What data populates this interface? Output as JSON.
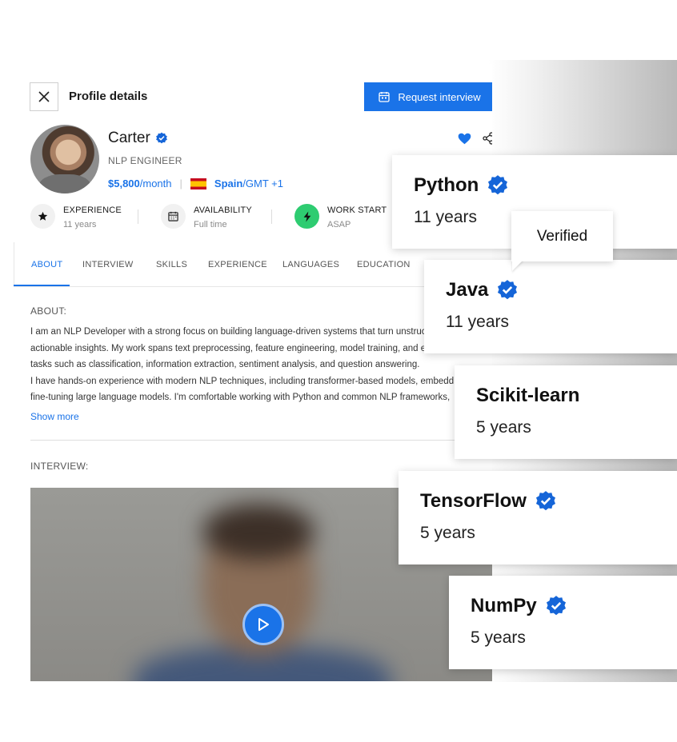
{
  "header": {
    "title": "Profile details",
    "request_button": "Request interview"
  },
  "profile": {
    "name": "Carter",
    "role": "NLP ENGINEER",
    "rate_amount": "$5,800",
    "rate_unit": "/month",
    "country": "Spain",
    "timezone": "/GMT +1"
  },
  "stats": [
    {
      "label": "EXPERIENCE",
      "value": "11 years",
      "icon": "star-icon"
    },
    {
      "label": "AVAILABILITY",
      "value": "Full time",
      "icon": "calendar-icon"
    },
    {
      "label": "WORK START",
      "value": "ASAP",
      "icon": "bolt-icon"
    }
  ],
  "tabs": [
    "ABOUT",
    "INTERVIEW",
    "SKILLS",
    "EXPERIENCE",
    "LANGUAGES",
    "EDUCATION"
  ],
  "about": {
    "heading": "ABOUT:",
    "lines": [
      "I am an NLP Developer with a strong focus on building language-driven systems that turn unstruc",
      "actionable insights. My work spans text preprocessing, feature engineering, model training, and e",
      "tasks such as classification, information extraction, sentiment analysis, and question answering.",
      "I have hands-on experience with modern NLP techniques, including transformer-based models, embedd",
      "fine-tuning large language models. I'm comfortable working with Python and common NLP frameworks,"
    ],
    "show_more": "Show more"
  },
  "interview": {
    "heading": "INTERVIEW:"
  },
  "skill_cards": [
    {
      "skill": "Python",
      "years": "11 years",
      "verified": true
    },
    {
      "skill": "Java",
      "years": "11 years",
      "verified": true
    },
    {
      "skill": "Scikit-learn",
      "years": "5 years",
      "verified": false
    },
    {
      "skill": "TensorFlow",
      "years": "5 years",
      "verified": true
    },
    {
      "skill": "NumPy",
      "years": "5 years",
      "verified": true
    }
  ],
  "tooltip": "Verified",
  "colors": {
    "accent": "#1a73e8",
    "badge": "#1565d8",
    "work_start": "#2ecc71"
  }
}
